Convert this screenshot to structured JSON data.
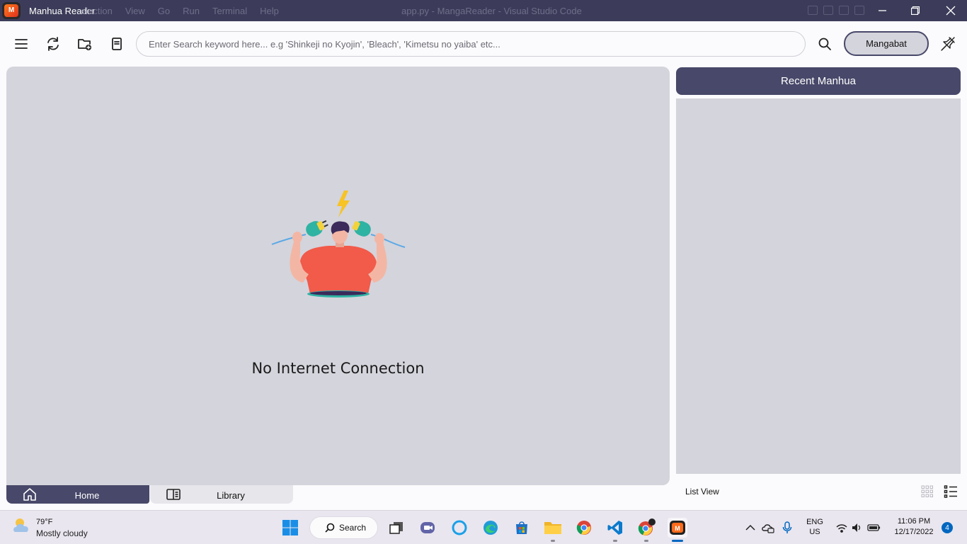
{
  "titlebar": {
    "app_title": "Manhua Reader",
    "behind_menu": [
      "election",
      "View",
      "Go",
      "Run",
      "Terminal",
      "Help"
    ],
    "behind_title": "app.py - MangaReader - Visual Studio Code",
    "logo_text": "M"
  },
  "toolbar": {
    "search_placeholder": "Enter Search keyword here... e.g 'Shinkeji no Kyojin', 'Bleach', 'Kimetsu no yaiba' etc...",
    "search_value": "",
    "source_label": "Mangabat"
  },
  "main": {
    "offline_message": "No Internet Connection"
  },
  "bottom_tabs": [
    {
      "label": "Home",
      "active": true
    },
    {
      "label": "Library",
      "active": false
    }
  ],
  "sidebar": {
    "header": "Recent Manhua",
    "view_label": "List View",
    "items": []
  },
  "taskbar": {
    "weather_temp": "79°F",
    "weather_condition": "Mostly cloudy",
    "search_label": "Search",
    "lang_top": "ENG",
    "lang_bottom": "US",
    "time": "11:06 PM",
    "date": "12/17/2022",
    "notification_count": "4"
  },
  "colors": {
    "titlebar_bg": "#3c3c5a",
    "accent": "#48486a",
    "panel_bg": "#d4d4dc",
    "page_bg": "#fbfbfd"
  }
}
